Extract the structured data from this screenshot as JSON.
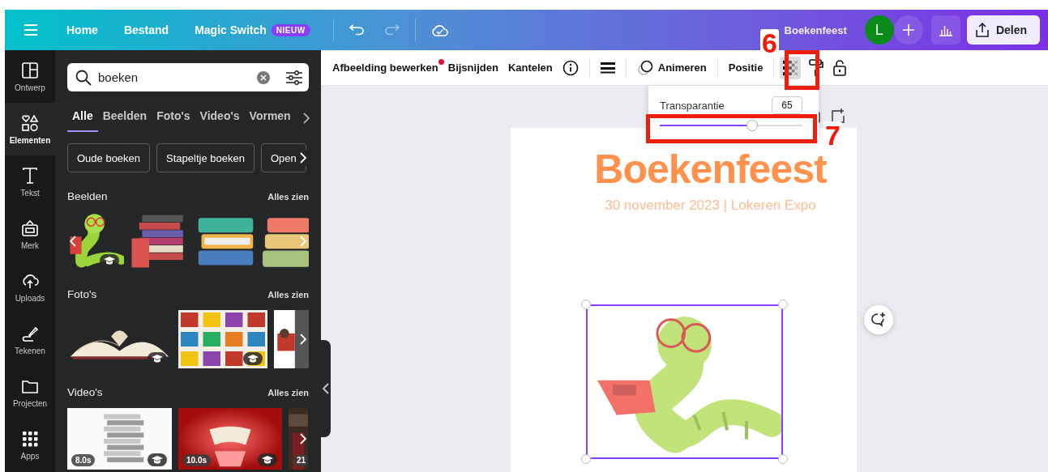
{
  "topbar": {
    "nav": [
      {
        "label": "Home"
      },
      {
        "label": "Bestand"
      },
      {
        "label": "Magic Switch",
        "badge": "NIEUW"
      }
    ],
    "title": "Boekenfeest",
    "avatar": "L",
    "share": "Delen"
  },
  "rail": [
    {
      "label": "Ontwerp",
      "kind": "layout",
      "selected": false
    },
    {
      "label": "Elementen",
      "kind": "shapes",
      "selected": true
    },
    {
      "label": "Tekst",
      "kind": "text",
      "selected": false
    },
    {
      "label": "Merk",
      "kind": "brand",
      "selected": false
    },
    {
      "label": "Uploads",
      "kind": "upload",
      "selected": false
    },
    {
      "label": "Tekenen",
      "kind": "draw",
      "selected": false
    },
    {
      "label": "Projecten",
      "kind": "folder",
      "selected": false
    },
    {
      "label": "Apps",
      "kind": "apps",
      "selected": false
    }
  ],
  "panel": {
    "search": {
      "value": "boeken"
    },
    "tabs": [
      {
        "label": "Alle",
        "selected": true
      },
      {
        "label": "Beelden",
        "selected": false
      },
      {
        "label": "Foto's",
        "selected": false
      },
      {
        "label": "Video's",
        "selected": false
      },
      {
        "label": "Vormen",
        "selected": false
      }
    ],
    "chips": [
      "Oude boeken",
      "Stapeltje boeken",
      "Open"
    ],
    "sections": [
      {
        "title": "Beelden",
        "link": "Alles zien",
        "kind": "graphics",
        "items": [
          {
            "kind": "picture",
            "badge": true
          },
          {
            "kind": "picture",
            "badge": false
          },
          {
            "kind": "picture",
            "badge": false
          },
          {
            "kind": "picture",
            "badge": false
          }
        ]
      },
      {
        "title": "Foto's",
        "link": "Alles zien",
        "kind": "photos",
        "items": [
          {
            "kind": "picture",
            "badge": true
          },
          {
            "kind": "picture",
            "badge": true
          },
          {
            "kind": "picture",
            "badge": false
          }
        ]
      },
      {
        "title": "Video's",
        "link": "Alles zien",
        "kind": "videos",
        "items": [
          {
            "kind": "picture",
            "badge": true,
            "duration": "8.0s"
          },
          {
            "kind": "picture",
            "badge": true,
            "duration": "10.0s"
          },
          {
            "kind": "picture",
            "badge": false,
            "duration": "21"
          }
        ]
      }
    ]
  },
  "toolbar": {
    "edit_image": {
      "label": "Afbeelding bewerken",
      "notification": true
    },
    "crop": "Bijsnijden",
    "flip": "Kantelen",
    "animate": "Animeren",
    "position": "Positie",
    "transparency_selected": true
  },
  "transparency": {
    "label": "Transparantie",
    "value": "65",
    "level": 0.65
  },
  "canvas": {
    "title": "Boekenfeest",
    "subtitle": "30 november 2023 | Lokeren Expo",
    "element_selected": true
  },
  "annotations": [
    {
      "label": "6"
    },
    {
      "label": "7"
    }
  ]
}
